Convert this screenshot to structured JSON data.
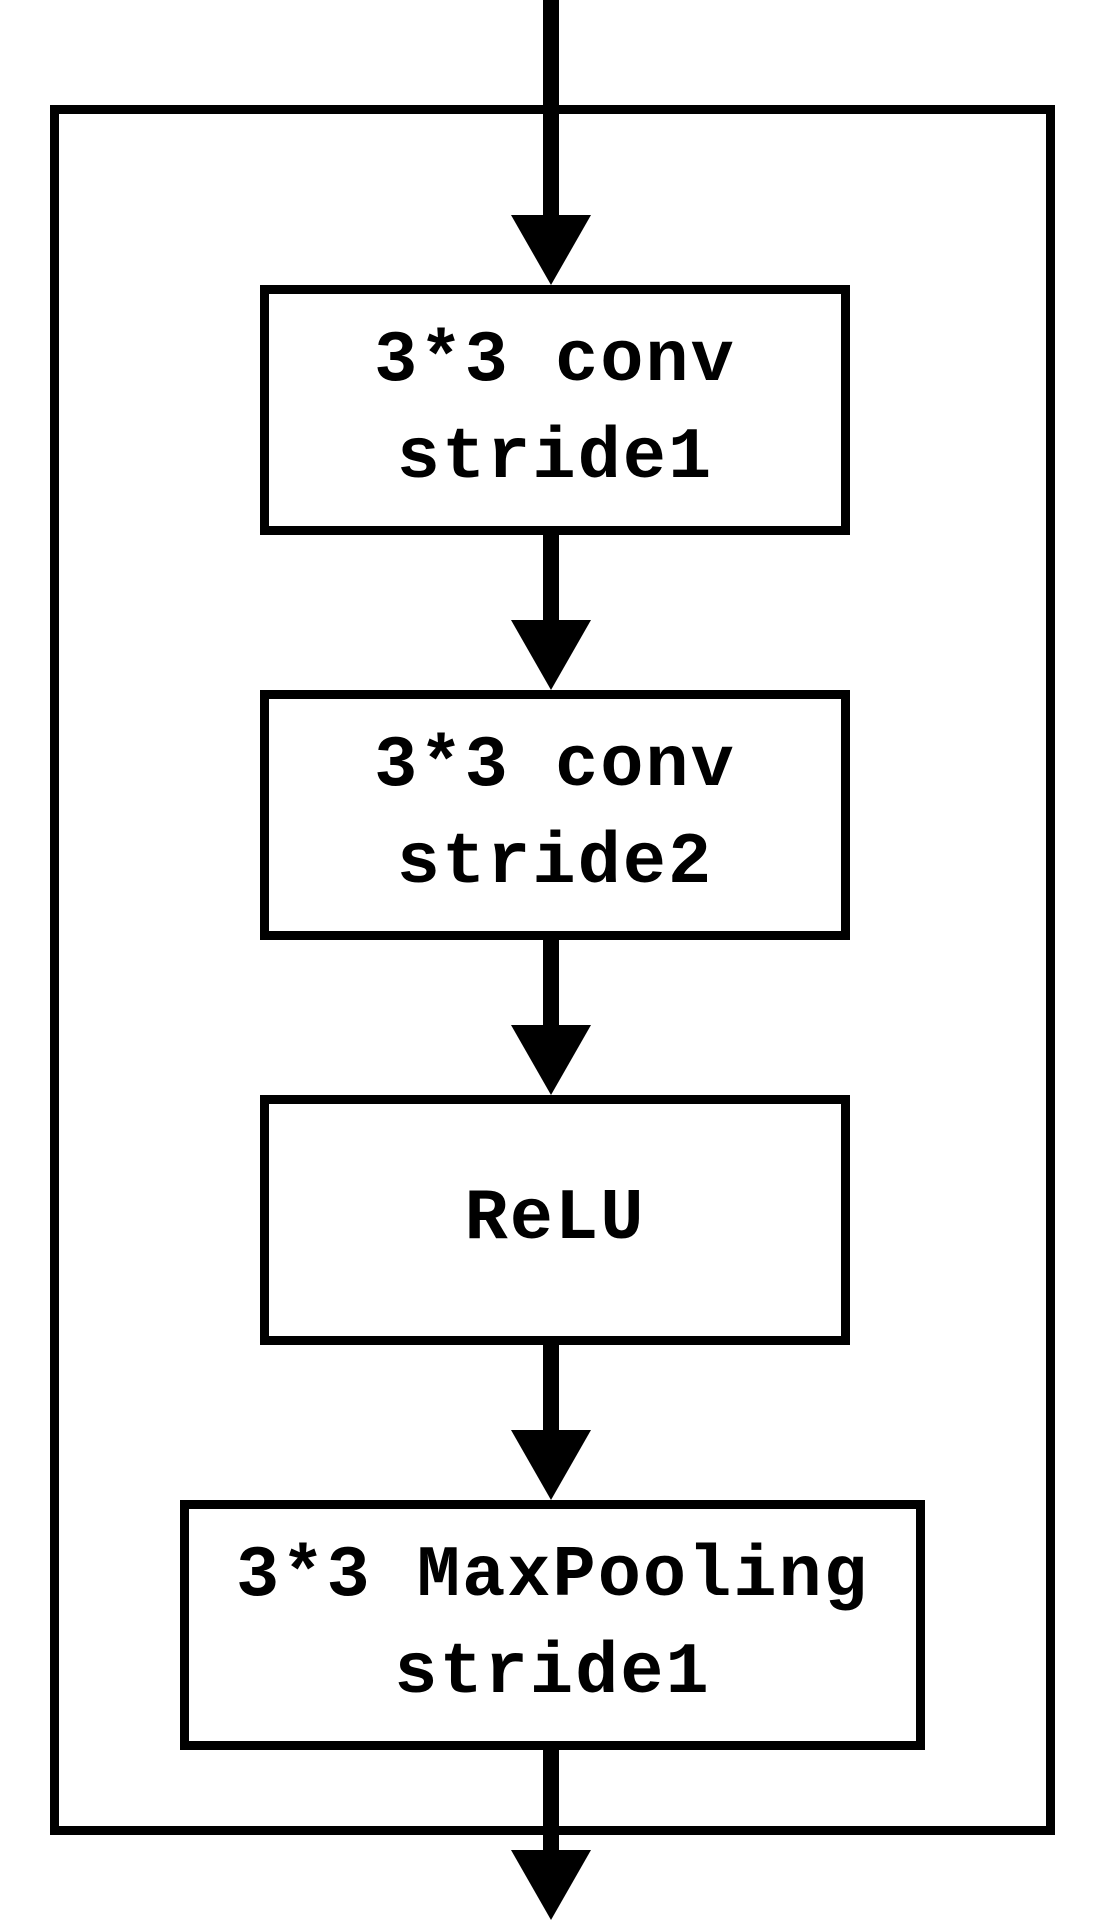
{
  "diagram": {
    "blocks": [
      {
        "line1": "3*3 conv",
        "line2": "stride1"
      },
      {
        "line1": "3*3 conv",
        "line2": "stride2"
      },
      {
        "line1": "ReLU",
        "line2": ""
      },
      {
        "line1": "3*3 MaxPooling",
        "line2": "stride1"
      }
    ]
  }
}
